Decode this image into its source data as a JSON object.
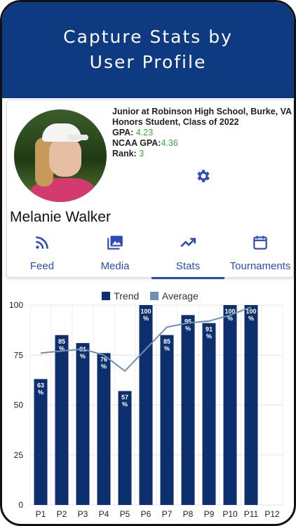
{
  "banner": {
    "title": "Capture Stats by\nUser Profile"
  },
  "profile": {
    "school_line": "Junior at Robinson High School, Burke, VA",
    "honors_line": "Honors Student, Class of 2022",
    "gpa_label": "GPA:",
    "gpa_value": "4.23",
    "ncaa_label": "NCAA GPA:",
    "ncaa_value": "4.36",
    "rank_label": "Rank:",
    "rank_value": "3",
    "name": "Melanie Walker"
  },
  "tabs": [
    {
      "label": "Feed",
      "icon": "rss-icon",
      "active": false
    },
    {
      "label": "Media",
      "icon": "photo-library-icon",
      "active": false
    },
    {
      "label": "Stats",
      "icon": "trending-up-icon",
      "active": true
    },
    {
      "label": "Tournaments",
      "icon": "calendar-icon",
      "active": false
    }
  ],
  "colors": {
    "banner": "#0d3a80",
    "bar": "#0d2f6e",
    "trend_line": "#6f8fb5",
    "tab_accent": "#2b4bb8",
    "value_green": "#3aa845"
  },
  "chart_data": {
    "type": "bar",
    "categories": [
      "P1",
      "P2",
      "P3",
      "P4",
      "P5",
      "P6",
      "P7",
      "P8",
      "P9",
      "P10",
      "P11",
      "P12"
    ],
    "series": [
      {
        "name": "Trend",
        "values": [
          63,
          85,
          81,
          76,
          57,
          100,
          85,
          95,
          91,
          100,
          100,
          null
        ]
      },
      {
        "name": "Average",
        "values": [
          76,
          77,
          78,
          75,
          67,
          78,
          89,
          91,
          92,
          95,
          99,
          null
        ]
      }
    ],
    "data_labels": [
      "63\n%",
      "85\n%",
      "81\n%",
      "76\n%",
      "57\n%",
      "100\n%",
      "85\n%",
      "95\n%",
      "91\n%",
      "100\n%",
      "100\n%",
      ""
    ],
    "ylim": [
      0,
      100
    ],
    "yticks": [
      0,
      25,
      50,
      75,
      100
    ],
    "grid": true,
    "legend_position": "top-center"
  }
}
